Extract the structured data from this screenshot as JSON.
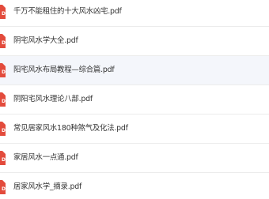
{
  "files": [
    {
      "name": "千万不能租住的十大风水凶宅.pdf",
      "icon": "pdf-icon"
    },
    {
      "name": "阴宅风水学大全.pdf",
      "icon": "pdf-icon"
    },
    {
      "name": "阳宅风水布局教程—综合篇.pdf",
      "icon": "pdf-icon"
    },
    {
      "name": "阴阳宅风水理论八部.pdf",
      "icon": "pdf-icon"
    },
    {
      "name": "常见居家风水180种煞气及化法.pdf",
      "icon": "pdf-icon"
    },
    {
      "name": "家居风水一点通.pdf",
      "icon": "pdf-icon"
    },
    {
      "name": "居家风水学_摘录.pdf",
      "icon": "pdf-icon"
    }
  ],
  "colors": {
    "pdf_red": "#e34b3c",
    "row_highlight": "#f4f6fb",
    "text": "#333333"
  }
}
